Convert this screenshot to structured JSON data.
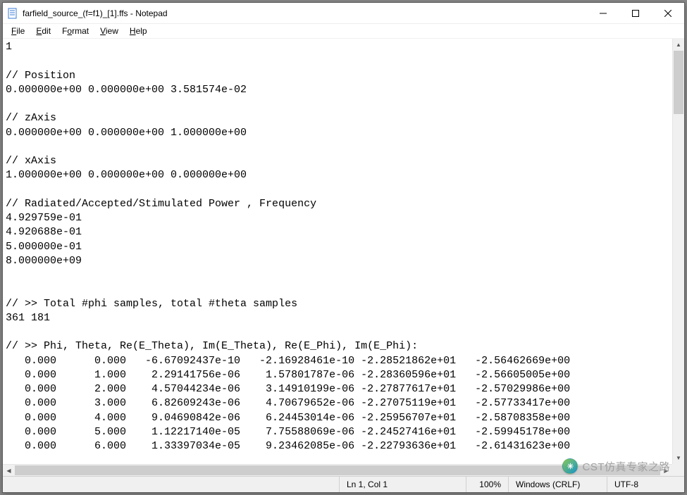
{
  "window": {
    "title": "farfield_source_(f=f1)_[1].ffs - Notepad",
    "icon_name": "notepad-icon"
  },
  "menu": {
    "file": "File",
    "edit": "Edit",
    "format": "Format",
    "view": "View",
    "help": "Help"
  },
  "status": {
    "position": "Ln 1, Col 1",
    "zoom": "100%",
    "line_ending": "Windows (CRLF)",
    "encoding": "UTF-8"
  },
  "watermark": {
    "text": "CST仿真专家之路"
  },
  "document": {
    "header_value": "1",
    "position_comment": "// Position",
    "position_values": "0.000000e+00 0.000000e+00 3.581574e-02",
    "zaxis_comment": "// zAxis",
    "zaxis_values": "0.000000e+00 0.000000e+00 1.000000e+00",
    "xaxis_comment": "// xAxis",
    "xaxis_values": "1.000000e+00 0.000000e+00 0.000000e+00",
    "power_comment": "// Radiated/Accepted/Stimulated Power , Frequency",
    "power_radiated": "4.929759e-01",
    "power_accepted": "4.920688e-01",
    "power_stimulated": "5.000000e-01",
    "frequency": "8.000000e+09",
    "samples_comment": "// >> Total #phi samples, total #theta samples",
    "samples_counts": "361 181",
    "columns_comment": "// >> Phi, Theta, Re(E_Theta), Im(E_Theta), Re(E_Phi), Im(E_Phi):",
    "rows": [
      "   0.000      0.000   -6.67092437e-10   -2.16928461e-10 -2.28521862e+01   -2.56462669e+00",
      "   0.000      1.000    2.29141756e-06    1.57801787e-06 -2.28360596e+01   -2.56605005e+00",
      "   0.000      2.000    4.57044234e-06    3.14910199e-06 -2.27877617e+01   -2.57029986e+00",
      "   0.000      3.000    6.82609243e-06    4.70679652e-06 -2.27075119e+01   -2.57733417e+00",
      "   0.000      4.000    9.04690842e-06    6.24453014e-06 -2.25956707e+01   -2.58708358e+00",
      "   0.000      5.000    1.12217140e-05    7.75588069e-06 -2.24527416e+01   -2.59945178e+00",
      "   0.000      6.000    1.33397034e-05    9.23462085e-06 -2.22793636e+01   -2.61431623e+00"
    ]
  }
}
